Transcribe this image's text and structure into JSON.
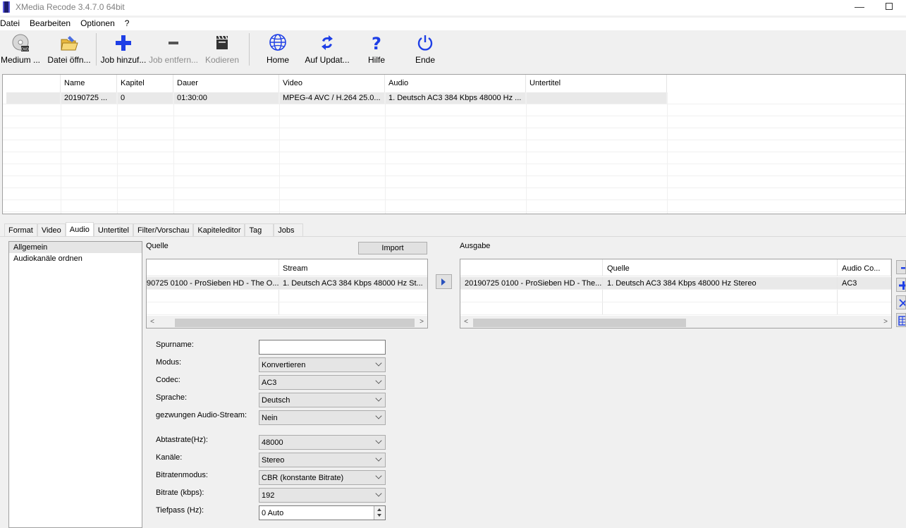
{
  "window": {
    "title": "XMedia Recode 3.4.7.0 64bit",
    "minimize_glyph": "—"
  },
  "menu": [
    "Datei",
    "Bearbeiten",
    "Optionen",
    "?"
  ],
  "toolbar": {
    "buttons": [
      {
        "label": "Medium ...",
        "icon": "disc-icon",
        "enabled": true
      },
      {
        "label": "Datei öffn...",
        "icon": "folder-open-icon",
        "enabled": true
      },
      {
        "label": "Job hinzuf...",
        "icon": "plus-icon",
        "enabled": true
      },
      {
        "label": "Job entfern...",
        "icon": "minus-icon",
        "enabled": false
      },
      {
        "label": "Kodieren",
        "icon": "clapperboard-icon",
        "enabled": false
      },
      {
        "label": "Home",
        "icon": "globe-icon",
        "enabled": true
      },
      {
        "label": "Auf Updat...",
        "icon": "refresh-icon",
        "enabled": true
      },
      {
        "label": "Hilfe",
        "icon": "question-icon",
        "enabled": true
      },
      {
        "label": "Ende",
        "icon": "power-icon",
        "enabled": true
      }
    ]
  },
  "joblist": {
    "columns": [
      "",
      "Name",
      "Kapitel",
      "Dauer",
      "Video",
      "Audio",
      "Untertitel"
    ],
    "rows": [
      [
        "",
        "20190725 ...",
        "0",
        "01:30:00",
        "MPEG-4 AVC / H.264 25.0...",
        "1. Deutsch AC3 384 Kbps 48000 Hz ...",
        ""
      ]
    ]
  },
  "tabs": {
    "items": [
      "Format",
      "Video",
      "Audio",
      "Untertitel",
      "Filter/Vorschau",
      "Kapiteleditor",
      "Tag",
      "Jobs"
    ],
    "active": "Audio"
  },
  "leftlist": {
    "items": [
      "Allgemein",
      "Audiokanäle ordnen"
    ],
    "selected": "Allgemein"
  },
  "source": {
    "label": "Quelle",
    "import_label": "Import",
    "columns": [
      "",
      "Stream"
    ],
    "rows": [
      [
        "90725 0100 - ProSieben HD - The O...",
        "1. Deutsch AC3 384 Kbps 48000 Hz St..."
      ]
    ],
    "scroll_left": "<",
    "scroll_right": ">"
  },
  "output": {
    "label": "Ausgabe",
    "columns": [
      "",
      "Quelle",
      "Audio Co..."
    ],
    "rows": [
      [
        "20190725 0100 - ProSieben HD - The...",
        "1. Deutsch AC3 384 Kbps 48000 Hz Stereo",
        "AC3"
      ]
    ],
    "scroll_left": "<",
    "scroll_right": ">"
  },
  "form": {
    "spurname": {
      "label": "Spurname:",
      "value": ""
    },
    "modus": {
      "label": "Modus:",
      "value": "Konvertieren"
    },
    "codec": {
      "label": "Codec:",
      "value": "AC3"
    },
    "sprache": {
      "label": "Sprache:",
      "value": "Deutsch"
    },
    "forced": {
      "label": "gezwungen Audio-Stream:",
      "value": "Nein"
    },
    "abtastrate": {
      "label": "Abtastrate(Hz):",
      "value": "48000"
    },
    "kanaele": {
      "label": "Kanäle:",
      "value": "Stereo"
    },
    "bitratenmodus": {
      "label": "Bitratenmodus:",
      "value": "CBR (konstante Bitrate)"
    },
    "bitrate": {
      "label": "Bitrate (kbps):",
      "value": "192"
    },
    "tiefpass": {
      "label": "Tiefpass (Hz):",
      "value": "0 Auto"
    }
  },
  "colors": {
    "accent_blue": "#1e3fe6",
    "background": "#f0f0f0"
  }
}
